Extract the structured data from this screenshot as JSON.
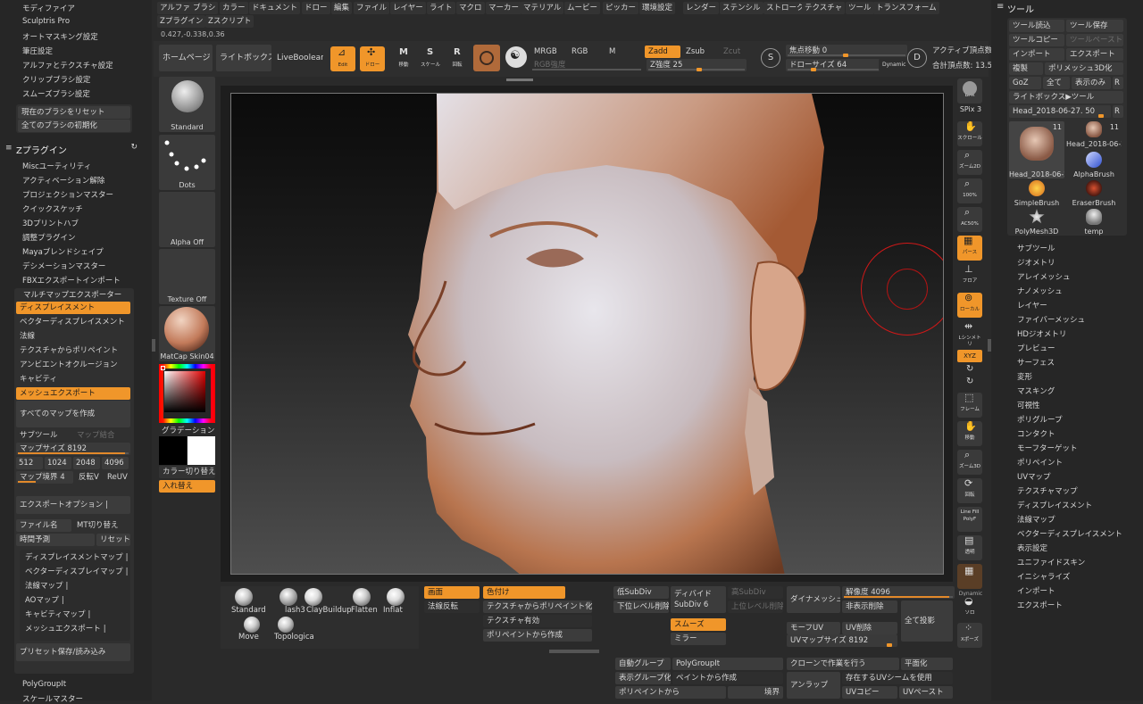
{
  "menu": {
    "items": [
      "アルファ",
      "ブラシ",
      "カラー",
      "ドキュメント",
      "ドロー",
      "編集",
      "ファイル",
      "レイヤー",
      "ライト",
      "マクロ",
      "マーカー",
      "マテリアル",
      "ムービー",
      "ピッカー",
      "環境設定",
      "レンダー",
      "ステンシル",
      "ストローク",
      "テクスチャ",
      "ツール",
      "トランスフォーム"
    ],
    "row2": [
      "Zプラグイン",
      "Zスクリプト"
    ],
    "coords": "0.427,-0.338,0.36"
  },
  "left_top_list": [
    "モディファイア",
    "Sculptris Pro",
    "オートマスキング設定",
    "筆圧設定",
    "アルファとテクスチャ設定",
    "クリップブラシ設定",
    "スムーズブラシ設定"
  ],
  "brush_reset": {
    "reset_current": "現在のブラシをリセット",
    "reset_all": "全てのブラシの初期化"
  },
  "zplugin": {
    "title": "Zプラグイン",
    "items": [
      "Miscユーティリティ",
      "アクティベーション解除",
      "プロジェクションマスター",
      "クイックスケッチ",
      "3Dプリントハブ",
      "調整プラグイン",
      "Mayaブレンドシェイプ",
      "デシメーションマスター",
      "FBXエクスポートインポート"
    ]
  },
  "multimap": {
    "title": "マルチマップエクスポーター",
    "options": [
      "ディスプレイスメント",
      "ベクターディスプレイスメント",
      "法線",
      "テクスチャからポリペイント",
      "アンビエントオクルージョン",
      "キャビティ",
      "メッシュエクスポート"
    ],
    "create_all": "すべてのマップを作成",
    "subtool": "サブツール",
    "map_merge": "マップ結合",
    "map_size_label": "マップサイズ",
    "map_size_value": "8192",
    "sizes": [
      "512",
      "1024",
      "2048",
      "4096"
    ],
    "map_border_label": "マップ境界",
    "map_border_value": "4",
    "flip_v": "反転V",
    "reuv": "ReUV",
    "export_options": "エクスポートオプション",
    "file_name": "ファイル名",
    "mt_switch": "MT切り替え",
    "time_estimate": "時間予測",
    "reset": "リセット",
    "maps": [
      "ディスプレイスメントマップ",
      "ベクターディスプレイマップ",
      "法線マップ",
      "AOマップ",
      "キャビティマップ",
      "メッシュエクスポート"
    ],
    "preset": "プリセット保存/読み込み"
  },
  "bottom_left": [
    "PolyGroupIt",
    "スケールマスター"
  ],
  "top_shelf": {
    "home": "ホームページ",
    "lightbox": "ライトボックス",
    "liveboolean": "LiveBoolean",
    "edit": "Edit",
    "draw": "ドロー",
    "move": "移動",
    "scale": "スケール",
    "rotate": "回転",
    "mrgb": "MRGB",
    "rgb": "RGB",
    "m": "M",
    "zadd": "Zadd",
    "zsub": "Zsub",
    "zcut": "Zcut",
    "rgb_intensity": "RGB強度",
    "z_intensity_label": "Z強度",
    "z_intensity_value": "25",
    "focal_label": "焦点移動",
    "focal_value": "0",
    "draw_size_label": "ドローサイズ",
    "draw_size_value": "64",
    "dynamic": "Dynamic",
    "active_points": "アクティブ頂点数",
    "total_points": "合計頂点数: 13.5"
  },
  "left_thumbs": {
    "brush": "Standard",
    "stroke": "Dots",
    "alpha": "Alpha Off",
    "texture": "Texture Off",
    "material": "MatCap Skin04",
    "gradient": "グラデーション",
    "color_switch": "カラー切り替え",
    "swap": "入れ替え"
  },
  "right_shelf": {
    "bpr": "BPR",
    "spix": "SPix 3",
    "scroll": "スクロール",
    "zoom2d": "ズーム2D",
    "pct100": "100%",
    "ac50": "AC50%",
    "perspective": "パース",
    "floor": "フロア",
    "local": "ローカル",
    "symmetry": "Lシンメトリ",
    "xyz": "XYZ",
    "frame": "フレーム",
    "move": "移動",
    "zoom3d": "ズーム3D",
    "rotate": "回転",
    "linefill": "Line Fill",
    "polyf": "PolyF",
    "transparent": "透明",
    "dynamic": "Dynamic",
    "solo": "ソロ",
    "xpose": "Xポーズ"
  },
  "tool_panel": {
    "title": "ツール",
    "load": "ツール読込",
    "save": "ツール保存",
    "copy": "ツールコピー",
    "paste": "ツールペースト",
    "import": "インポート",
    "export": "エクスポート",
    "clone": "複製",
    "make_3d": "ポリメッシュ3D化",
    "goz": "GoZ",
    "all": "全て",
    "visible": "表示のみ",
    "r": "R",
    "lightbox_tool": "ライトボックス▶ツール",
    "current_tool": "Head_2018-06-27. 50",
    "tools": [
      {
        "name": "Head_2018-06-2",
        "count": "11"
      },
      {
        "name": "Head_2018-06-2",
        "count": "11"
      },
      {
        "name": "AlphaBrush",
        "count": ""
      },
      {
        "name": "SimpleBrush",
        "count": ""
      },
      {
        "name": "EraserBrush",
        "count": ""
      },
      {
        "name": "PolyMesh3D",
        "count": ""
      },
      {
        "name": "temp",
        "count": ""
      }
    ],
    "submenus": [
      "サブツール",
      "ジオメトリ",
      "アレイメッシュ",
      "ナノメッシュ",
      "レイヤー",
      "ファイバーメッシュ",
      "HDジオメトリ",
      "プレビュー",
      "サーフェス",
      "変形",
      "マスキング",
      "可視性",
      "ポリグループ",
      "コンタクト",
      "モーフターゲット",
      "ポリペイント",
      "UVマップ",
      "テクスチャマップ",
      "ディスプレイスメント",
      "法線マップ",
      "ベクターディスプレイスメント",
      "表示設定",
      "ユニファイドスキン",
      "イニシャライズ",
      "インポート",
      "エクスポート"
    ]
  },
  "bottom_shelf": {
    "brushes": [
      "Standard",
      "ClayBuildup",
      "Flatten",
      "Inflat"
    ],
    "brushes2": [
      "Move",
      "Topologica"
    ],
    "clay_partial": "lash3",
    "screen": "画面",
    "flip_normals": "法線反転",
    "colorize": "色付け",
    "tex_to_poly": "テクスチャからポリペイント化",
    "tex_enabled": "テクスチャ有効",
    "from_poly": "ポリペイントから作成",
    "low_subdiv": "低SubDiv",
    "del_lower": "下位レベル削除",
    "divide": "ディバイド",
    "subdiv_label": "SubDiv",
    "subdiv_value": "6",
    "high_subdiv": "高SubDiv",
    "del_higher": "上位レベル削除",
    "smooth": "スムーズ",
    "mirror": "ミラー",
    "dynamesh": "ダイナメッシュ",
    "resolution_label": "解像度",
    "resolution_value": "4096",
    "del_hidden": "非表示削除",
    "morph_uv": "モーフUV",
    "uv_delete": "UV削除",
    "uv_map_size_label": "UVマップサイズ",
    "uv_map_size_value": "8192",
    "project_all": "全て投影",
    "auto_group": "自動グループ",
    "polygroupit": "PolyGroupIt",
    "clone_work": "クローンで作業を行う",
    "flatten": "平面化",
    "group_visible": "表示グループ化",
    "from_paint": "ペイントから作成",
    "unwrap": "アンラップ",
    "use_uv_seams": "存在するUVシームを使用",
    "from_polypaint": "ポリペイントから",
    "border": "境界",
    "uv_copy": "UVコピー",
    "uv_paste": "UVペースト"
  }
}
